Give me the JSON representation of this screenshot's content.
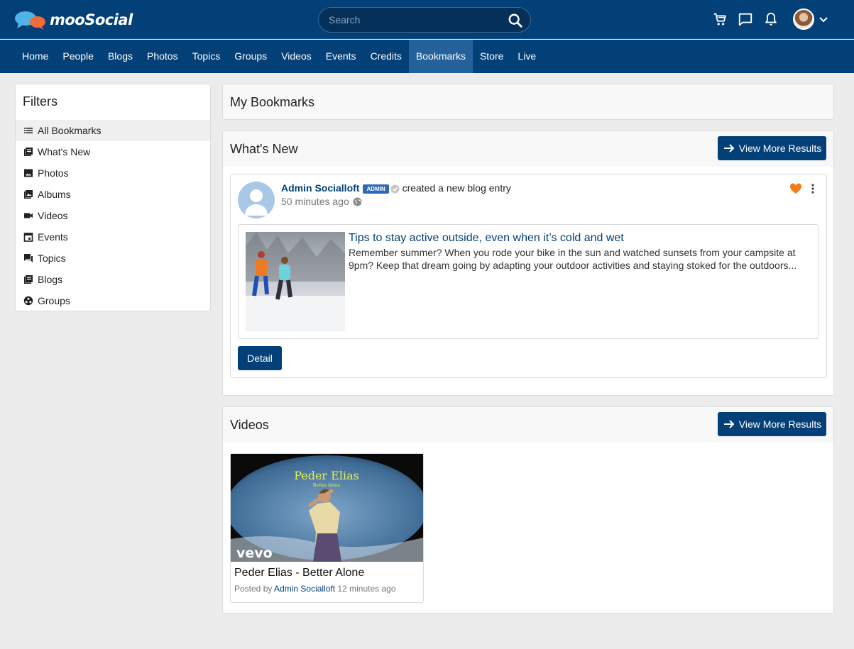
{
  "brand": {
    "name": "mooSocial"
  },
  "search": {
    "placeholder": "Search"
  },
  "nav": [
    {
      "label": "Home"
    },
    {
      "label": "People"
    },
    {
      "label": "Blogs"
    },
    {
      "label": "Photos"
    },
    {
      "label": "Topics"
    },
    {
      "label": "Groups"
    },
    {
      "label": "Videos"
    },
    {
      "label": "Events"
    },
    {
      "label": "Credits"
    },
    {
      "label": "Bookmarks",
      "active": true
    },
    {
      "label": "Store"
    },
    {
      "label": "Live"
    }
  ],
  "filters": {
    "title": "Filters",
    "items": [
      {
        "label": "All Bookmarks",
        "icon": "list-icon",
        "active": true
      },
      {
        "label": "What's New",
        "icon": "feed-icon"
      },
      {
        "label": "Photos",
        "icon": "photo-icon"
      },
      {
        "label": "Albums",
        "icon": "albums-icon"
      },
      {
        "label": "Videos",
        "icon": "video-icon"
      },
      {
        "label": "Events",
        "icon": "calendar-icon"
      },
      {
        "label": "Topics",
        "icon": "topics-icon"
      },
      {
        "label": "Blogs",
        "icon": "blogs-icon"
      },
      {
        "label": "Groups",
        "icon": "groups-icon"
      }
    ]
  },
  "page": {
    "title": "My Bookmarks"
  },
  "whats_new": {
    "title": "What's New",
    "view_more": "View More Results",
    "post": {
      "author": "Admin Socialloft",
      "badge": "ADMIN",
      "action": "created a new blog entry",
      "time": "50 minutes ago",
      "attachment": {
        "title": "Tips to stay active outside, even when it’s cold and wet",
        "description": "Remember summer? When you rode your bike in the sun and watched sunsets from your campsite at 9pm? Keep that dream going by adapting your outdoor activities and staying stoked for the outdoors..."
      },
      "detail_label": "Detail"
    }
  },
  "videos": {
    "title": "Videos",
    "view_more": "View More Results",
    "items": [
      {
        "title": "Peder Elias - Better Alone",
        "thumb_title": "Peder Elias",
        "thumb_subtitle": "Better Alone",
        "thumb_brand": "vevo",
        "posted_by_prefix": "Posted by",
        "author": "Admin Socialloft",
        "time": "12 minutes ago"
      }
    ]
  },
  "colors": {
    "primary": "#034078",
    "active_nav": "#25629b",
    "heart": "#f07d1c"
  }
}
